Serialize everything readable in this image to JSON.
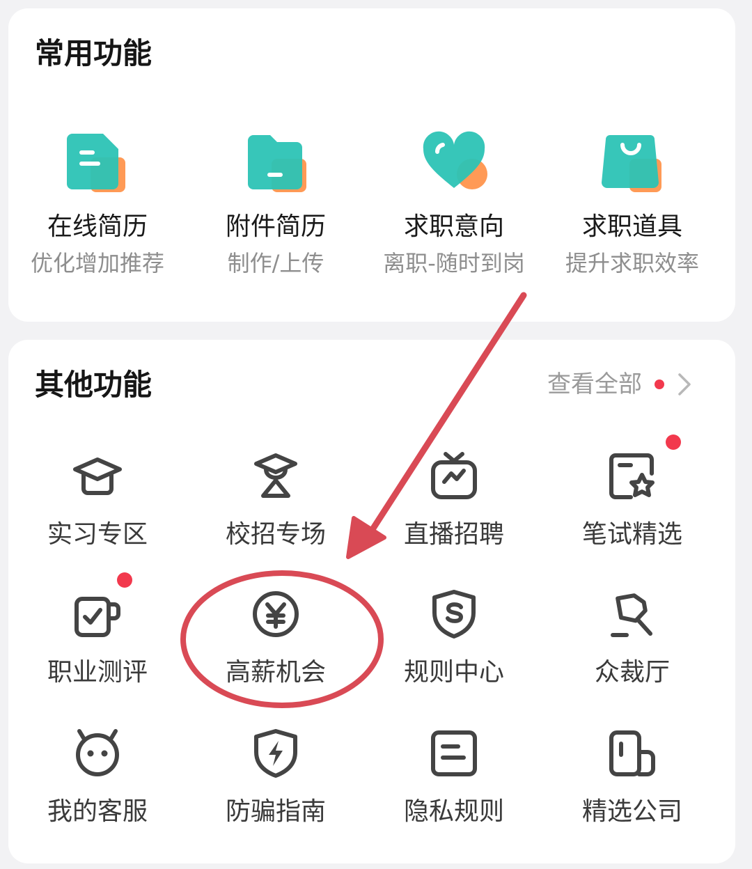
{
  "common": {
    "title": "常用功能",
    "items": [
      {
        "label": "在线简历",
        "sub": "优化增加推荐",
        "icon": "online-resume-icon"
      },
      {
        "label": "附件简历",
        "sub": "制作/上传",
        "icon": "attachment-resume-icon"
      },
      {
        "label": "求职意向",
        "sub": "离职-随时到岗",
        "icon": "job-intention-heart-icon"
      },
      {
        "label": "求职道具",
        "sub": "提升求职效率",
        "icon": "job-tools-bag-icon"
      }
    ]
  },
  "other": {
    "title": "其他功能",
    "view_all": "查看全部",
    "items": [
      {
        "label": "实习专区",
        "icon": "graduation-cap-icon"
      },
      {
        "label": "校招专场",
        "icon": "student-hat-icon"
      },
      {
        "label": "直播招聘",
        "icon": "tv-live-icon"
      },
      {
        "label": "笔试精选",
        "icon": "star-card-icon"
      },
      {
        "label": "职业测评",
        "icon": "check-paper-icon"
      },
      {
        "label": "高薪机会",
        "icon": "yen-coin-icon"
      },
      {
        "label": "规则中心",
        "icon": "shield-s-icon"
      },
      {
        "label": "众裁厅",
        "icon": "gavel-icon"
      },
      {
        "label": "我的客服",
        "icon": "service-face-icon"
      },
      {
        "label": "防骗指南",
        "icon": "shield-lightning-icon"
      },
      {
        "label": "隐私规则",
        "icon": "document-icon"
      },
      {
        "label": "精选公司",
        "icon": "building-icon"
      }
    ]
  },
  "colors": {
    "teal": "#2cc3b5",
    "orange": "#ff9a56",
    "annotation_red": "#d94a55",
    "badge_red": "#f2394d"
  }
}
